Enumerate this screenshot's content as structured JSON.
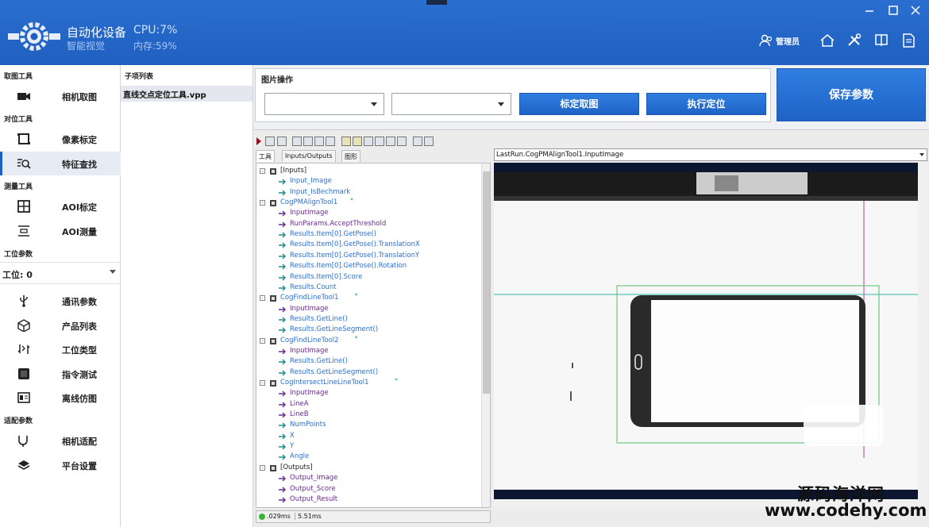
{
  "header": {
    "app_title": "自动化设备",
    "app_subtitle": "智能视觉",
    "cpu": "CPU:7%",
    "memory": "内存:59%",
    "admin_label": "管理员",
    "brand_color": "#1f5fbf",
    "window_controls": [
      "minimize-icon",
      "maximize-icon",
      "close-icon"
    ],
    "icons": [
      "user-icon",
      "home-icon",
      "tools-icon",
      "book-icon",
      "document-icon"
    ]
  },
  "sidebar": {
    "sections": [
      {
        "title": "取图工具",
        "items": [
          {
            "label": "相机取图",
            "icon": "camera-icon"
          }
        ]
      },
      {
        "title": "对位工具",
        "items": [
          {
            "label": "像素标定",
            "icon": "calibration-icon"
          },
          {
            "label": "特征查找",
            "icon": "feature-search-icon",
            "active": true
          }
        ]
      },
      {
        "title": "测量工具",
        "items": [
          {
            "label": "AOI标定",
            "icon": "grid-icon"
          },
          {
            "label": "AOI测量",
            "icon": "measure-icon"
          }
        ]
      },
      {
        "title": "工位参数",
        "station_label": "工位:",
        "station_value": "0",
        "items": [
          {
            "label": "通讯参数",
            "icon": "usb-icon"
          },
          {
            "label": "产品列表",
            "icon": "cube-icon"
          },
          {
            "label": "工位类型",
            "icon": "swap-icon"
          },
          {
            "label": "指令测试",
            "icon": "terminal-icon"
          },
          {
            "label": "离线仿图",
            "icon": "image-icon"
          }
        ]
      },
      {
        "title": "适配参数",
        "items": [
          {
            "label": "相机适配",
            "icon": "plug-icon"
          },
          {
            "label": "平台设置",
            "icon": "layers-icon"
          }
        ]
      }
    ]
  },
  "sublist": {
    "header": "子项列表",
    "items": [
      "直线交点定位工具.vpp"
    ]
  },
  "image_ops": {
    "title": "图片操作",
    "select1_value": "",
    "select2_value": "",
    "calibrate_button": "标定取图",
    "locate_button": "执行定位",
    "save_button": "保存参数"
  },
  "tool": {
    "tabs": [
      "工具",
      "Inputs/Outputs",
      "图形"
    ],
    "tree": [
      {
        "text": "[Inputs]",
        "level": 0,
        "type": "black",
        "expander": "-"
      },
      {
        "text": "Input_Image",
        "level": 1,
        "type": "link"
      },
      {
        "text": "Input_IsBechmark",
        "level": 1,
        "type": "link"
      },
      {
        "text": "CogPMAlignTool1",
        "level": 0,
        "type": "link",
        "expander": "-",
        "star": "*"
      },
      {
        "text": "InputImage",
        "level": 1,
        "type": "purple"
      },
      {
        "text": "RunParams.AcceptThreshold",
        "level": 1,
        "type": "purple"
      },
      {
        "text": "Results.Item[0].GetPose()",
        "level": 1,
        "type": "link"
      },
      {
        "text": "Results.Item[0].GetPose().TranslationX",
        "level": 1,
        "type": "link"
      },
      {
        "text": "Results.Item[0].GetPose().TranslationY",
        "level": 1,
        "type": "link"
      },
      {
        "text": "Results.Item[0].GetPose().Rotation",
        "level": 1,
        "type": "link"
      },
      {
        "text": "Results.Item[0].Score",
        "level": 1,
        "type": "link"
      },
      {
        "text": "Results.Count",
        "level": 1,
        "type": "link"
      },
      {
        "text": "CogFindLineTool1",
        "level": 0,
        "type": "link",
        "expander": "-",
        "star": "*"
      },
      {
        "text": "InputImage",
        "level": 1,
        "type": "purple"
      },
      {
        "text": "Results.GetLine()",
        "level": 1,
        "type": "link"
      },
      {
        "text": "Results.GetLineSegment()",
        "level": 1,
        "type": "link"
      },
      {
        "text": "CogFindLineTool2",
        "level": 0,
        "type": "link",
        "expander": "-",
        "star": "*"
      },
      {
        "text": "InputImage",
        "level": 1,
        "type": "purple"
      },
      {
        "text": "Results.GetLine()",
        "level": 1,
        "type": "link"
      },
      {
        "text": "Results.GetLineSegment()",
        "level": 1,
        "type": "link"
      },
      {
        "text": "CogIntersectLineLineTool1",
        "level": 0,
        "type": "link",
        "expander": "-",
        "star": "*"
      },
      {
        "text": "InputImage",
        "level": 1,
        "type": "purple"
      },
      {
        "text": "LineA",
        "level": 1,
        "type": "purple"
      },
      {
        "text": "LineB",
        "level": 1,
        "type": "purple"
      },
      {
        "text": "NumPoints",
        "level": 1,
        "type": "link"
      },
      {
        "text": "X",
        "level": 1,
        "type": "link"
      },
      {
        "text": "Y",
        "level": 1,
        "type": "link"
      },
      {
        "text": "Angle",
        "level": 1,
        "type": "link"
      },
      {
        "text": "[Outputs]",
        "level": 0,
        "type": "black",
        "expander": "-"
      },
      {
        "text": "Output_Image",
        "level": 1,
        "type": "purple"
      },
      {
        "text": "Output_Score",
        "level": 1,
        "type": "purple"
      },
      {
        "text": "Output_Result",
        "level": 1,
        "type": "purple"
      }
    ],
    "status_time1": ".029ms",
    "status_time2": "5.51ms",
    "image_selector": "LastRun.CogPMAlignTool1.InputImage"
  },
  "watermark": {
    "line1": "源码海洋网",
    "line2": "www.codehy.com"
  }
}
